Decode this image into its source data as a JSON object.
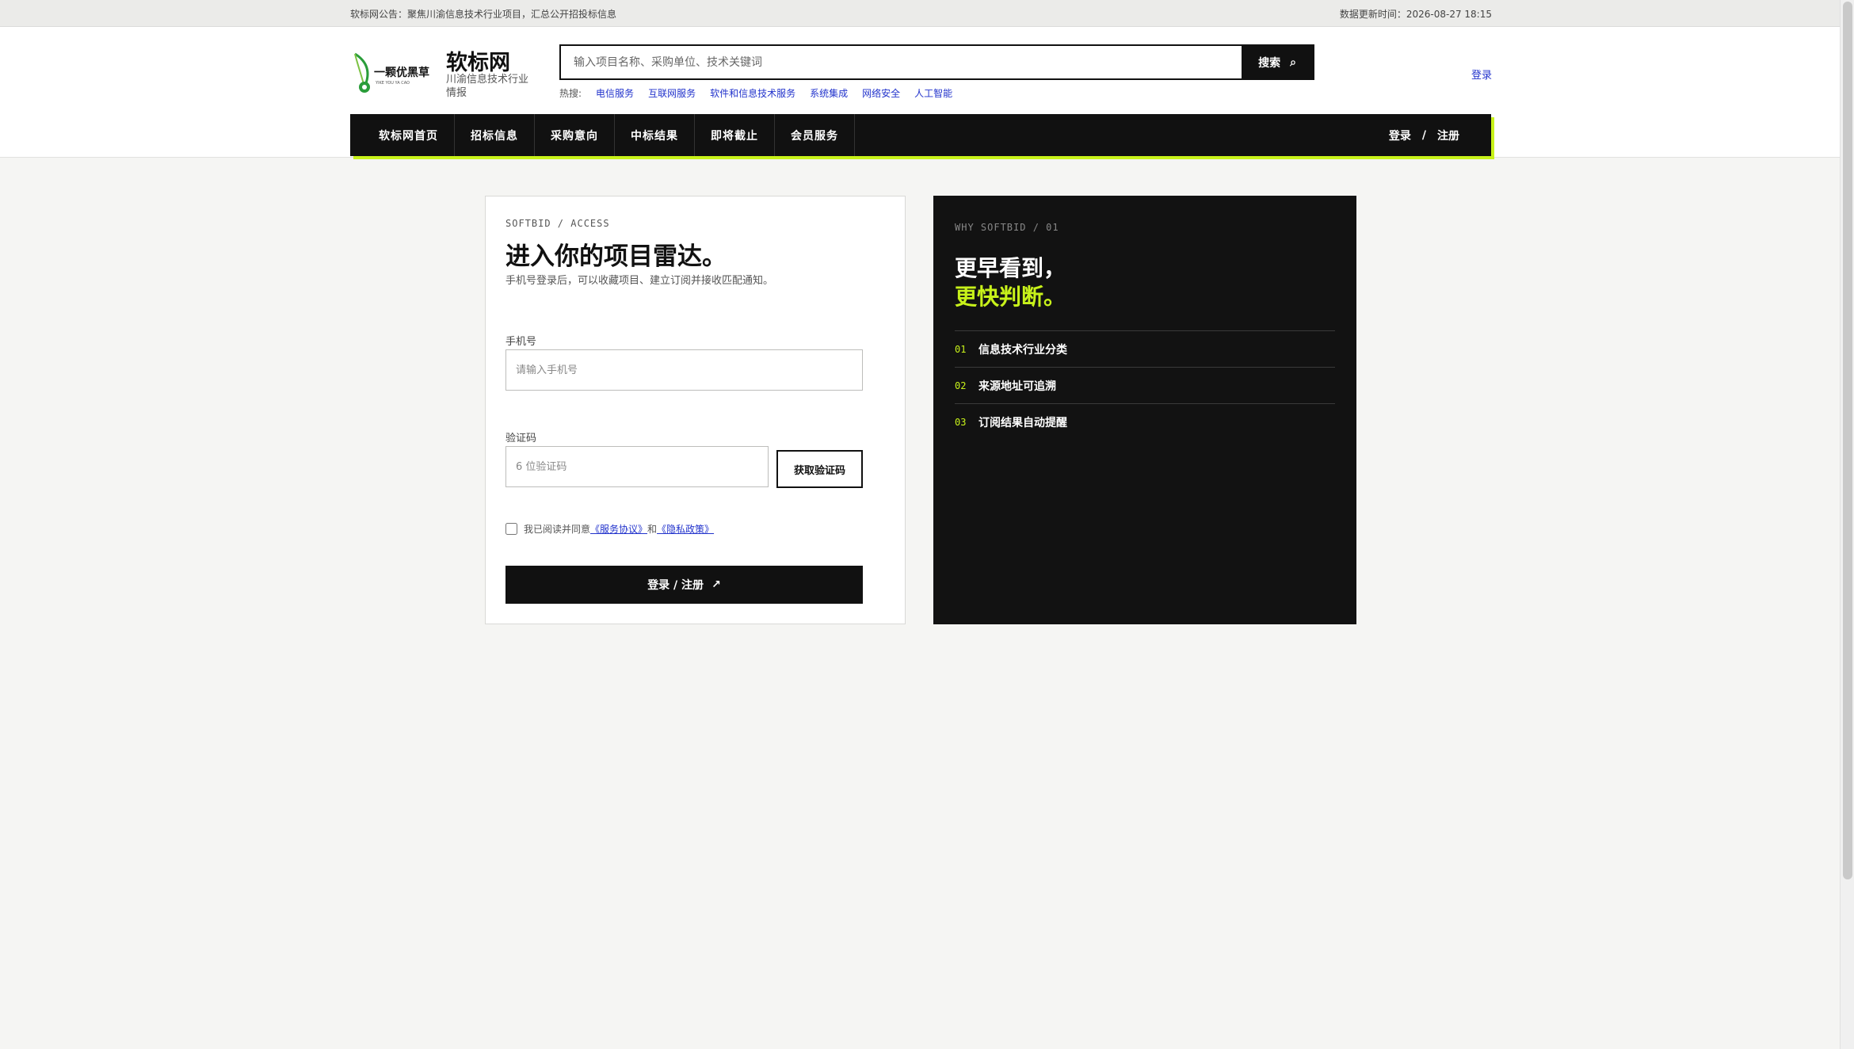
{
  "topbar": {
    "notice": "软标网公告：聚焦川渝信息技术行业项目，汇总公开招投标信息",
    "updated": "数据更新时间：2026-08-27 18:15"
  },
  "header": {
    "brand_name": "软标网",
    "brand_sub": "川渝信息技术行业情报",
    "logo_text": "一颗优黑草",
    "logo_sub": "YIKE YOU YA CAO",
    "search_placeholder": "输入项目名称、采购单位、技术关键词",
    "search_button": "搜索",
    "hot_label": "热搜:",
    "hot_tags": [
      "电信服务",
      "互联网服务",
      "软件和信息技术服务",
      "系统集成",
      "网络安全",
      "人工智能"
    ],
    "login_link": "登录"
  },
  "nav": {
    "items": [
      "软标网首页",
      "招标信息",
      "采购意向",
      "中标结果",
      "即将截止",
      "会员服务"
    ],
    "login": "登录",
    "sep": "/",
    "register": "注册"
  },
  "login_card": {
    "eyebrow": "SOFTBID / ACCESS",
    "title": "进入你的项目雷达。",
    "subtitle": "手机号登录后，可以收藏项目、建立订阅并接收匹配通知。",
    "phone_label": "手机号",
    "phone_placeholder": "请输入手机号",
    "code_label": "验证码",
    "code_placeholder": "6 位验证码",
    "code_button": "获取验证码",
    "agree_prefix": "我已阅读并同意",
    "terms": "《服务协议》",
    "and": "和",
    "privacy": "《隐私政策》",
    "submit": "登录 / 注册",
    "submit_arrow": "↗"
  },
  "panel": {
    "eyebrow": "WHY SOFTBID / 01",
    "headline_1": "更早看到，",
    "headline_2": "更快判断。",
    "features": [
      {
        "num": "01",
        "text": "信息技术行业分类"
      },
      {
        "num": "02",
        "text": "来源地址可追溯"
      },
      {
        "num": "03",
        "text": "订阅结果自动提醒"
      }
    ]
  },
  "colors": {
    "accent": "#c8f21a",
    "dark": "#111111",
    "link": "#2233cc"
  }
}
